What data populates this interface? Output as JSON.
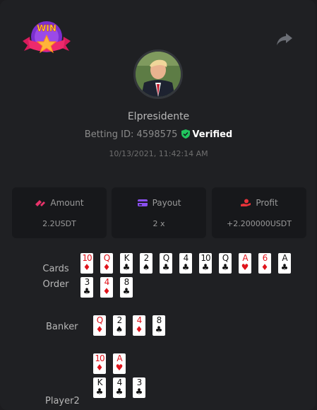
{
  "header": {
    "badge_text": "WIN",
    "share_icon": "share-arrow-icon"
  },
  "user": {
    "name": "Elpresidente",
    "betting_id_label": "Betting ID: 4598575",
    "verified_label": "Verified",
    "timestamp": "10/13/2021, 11:42:14 AM"
  },
  "stats": [
    {
      "title": "Amount",
      "value": "2.2USDT",
      "icon": "coins-icon",
      "color": "#e8336b"
    },
    {
      "title": "Payout",
      "value": "2 x",
      "icon": "credit-card-icon",
      "color": "#8a4ff0"
    },
    {
      "title": "Profit",
      "value": "+2.200000USDT",
      "icon": "hand-coin-icon",
      "color": "#e8333a"
    }
  ],
  "rows": {
    "cards_order": {
      "label": "Cards Order",
      "cards": [
        {
          "rank": "10",
          "suit": "♦"
        },
        {
          "rank": "Q",
          "suit": "♦"
        },
        {
          "rank": "K",
          "suit": "♣"
        },
        {
          "rank": "2",
          "suit": "♠"
        },
        {
          "rank": "Q",
          "suit": "♣"
        },
        {
          "rank": "4",
          "suit": "♣"
        },
        {
          "rank": "10",
          "suit": "♣"
        },
        {
          "rank": "Q",
          "suit": "♣"
        },
        {
          "rank": "A",
          "suit": "♥"
        },
        {
          "rank": "6",
          "suit": "♦"
        },
        {
          "rank": "A",
          "suit": "♣"
        },
        {
          "rank": "3",
          "suit": "♣"
        },
        {
          "rank": "4",
          "suit": "♦"
        },
        {
          "rank": "8",
          "suit": "♣"
        }
      ]
    },
    "banker": {
      "label": "Banker",
      "cards": [
        {
          "rank": "Q",
          "suit": "♦"
        },
        {
          "rank": "2",
          "suit": "♠"
        },
        {
          "rank": "4",
          "suit": "♦"
        },
        {
          "rank": "8",
          "suit": "♣"
        }
      ]
    },
    "player": {
      "label": "Player2",
      "cards": [
        {
          "rank": "10",
          "suit": "♦"
        },
        {
          "rank": "A",
          "suit": "♥"
        },
        {
          "rank": "K",
          "suit": "♣"
        },
        {
          "rank": "4",
          "suit": "♣"
        },
        {
          "rank": "3",
          "suit": "♣"
        }
      ]
    }
  },
  "colors": {
    "background": "#1c1c1f",
    "card_bg": "#17181b",
    "red_suit": "#e0141c",
    "verified_green": "#22c55e"
  }
}
